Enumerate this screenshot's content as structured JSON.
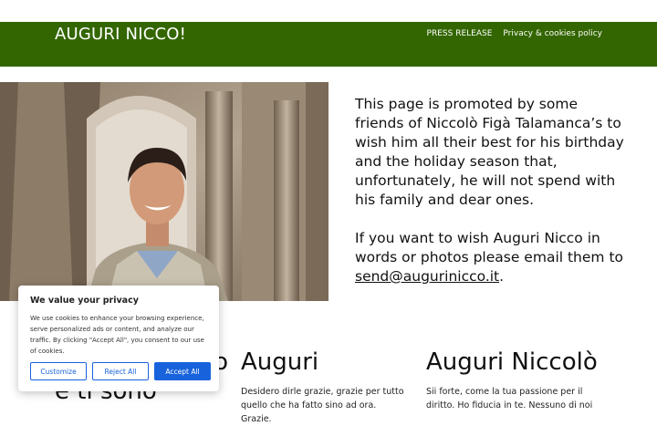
{
  "header": {
    "site_title": "AUGURI NICCO!",
    "nav": [
      "PRESS RELEASE",
      "Privacy & cookies policy"
    ]
  },
  "hero": {
    "paragraph1": "This page is promoted by some friends of Niccolò Figà Talamanca’s to wish him all their best for his birthday and the holiday season that, unfortunately, he will not spend with his family and dear ones.",
    "paragraph2_prefix": "If you want to wish Auguri Nicco in words or photos please email them to ",
    "email": "send@augurinicco.it",
    "paragraph2_suffix": "."
  },
  "columns": [
    {
      "title": "…o",
      "subtitle": "e ti sono",
      "text": ""
    },
    {
      "title": "Auguri",
      "text": "Desidero dirle grazie, grazie per tutto quello che ha fatto sino ad ora. Grazie."
    },
    {
      "title": "Auguri Niccolò",
      "text": "Sii forte, come la tua passione per il diritto. Ho fiducia in te. Nessuno di noi"
    }
  ],
  "cookie_banner": {
    "title": "We value your privacy",
    "text": "We use cookies to enhance your browsing experience, serve personalized ads or content, and analyze our traffic. By clicking \"Accept All\", you consent to our use of cookies.",
    "customize": "Customize",
    "reject": "Reject All",
    "accept": "Accept All"
  },
  "colors": {
    "header_bg": "#336600",
    "accent_blue": "#1863dc"
  }
}
